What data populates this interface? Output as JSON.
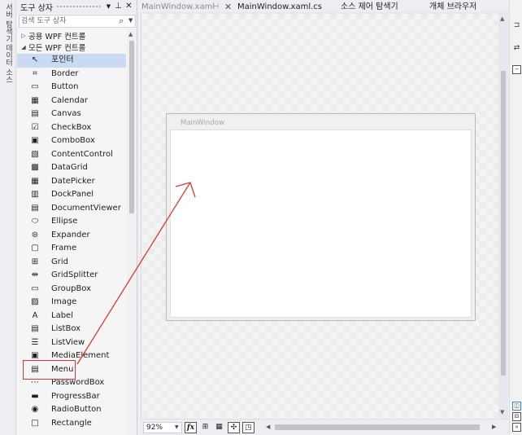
{
  "left_strip": {
    "items": [
      {
        "label": "서버 탐색기"
      },
      {
        "label": "데이터 소스"
      }
    ]
  },
  "toolbox": {
    "title": "도구 상자",
    "search_placeholder": "검색 도구 상자",
    "groups": [
      {
        "label": "공용 WPF 컨트롤",
        "state": "collapsed"
      },
      {
        "label": "모든 WPF 컨트롤",
        "state": "expanded"
      }
    ],
    "items": [
      {
        "label": "포인터",
        "icon": "pointer-icon",
        "glyph": "↖",
        "selected": true
      },
      {
        "label": "Border",
        "icon": "border-icon",
        "glyph": "⌗"
      },
      {
        "label": "Button",
        "icon": "button-icon",
        "glyph": "▭"
      },
      {
        "label": "Calendar",
        "icon": "calendar-icon",
        "glyph": "▦"
      },
      {
        "label": "Canvas",
        "icon": "canvas-icon",
        "glyph": "▤"
      },
      {
        "label": "CheckBox",
        "icon": "checkbox-icon",
        "glyph": "☑"
      },
      {
        "label": "ComboBox",
        "icon": "combobox-icon",
        "glyph": "▣"
      },
      {
        "label": "ContentControl",
        "icon": "contentcontrol-icon",
        "glyph": "▧"
      },
      {
        "label": "DataGrid",
        "icon": "datagrid-icon",
        "glyph": "▩"
      },
      {
        "label": "DatePicker",
        "icon": "datepicker-icon",
        "glyph": "▦"
      },
      {
        "label": "DockPanel",
        "icon": "dockpanel-icon",
        "glyph": "▥"
      },
      {
        "label": "DocumentViewer",
        "icon": "documentviewer-icon",
        "glyph": "▤"
      },
      {
        "label": "Ellipse",
        "icon": "ellipse-icon",
        "glyph": "⬭"
      },
      {
        "label": "Expander",
        "icon": "expander-icon",
        "glyph": "⊜"
      },
      {
        "label": "Frame",
        "icon": "frame-icon",
        "glyph": "▢"
      },
      {
        "label": "Grid",
        "icon": "grid-icon",
        "glyph": "⊞"
      },
      {
        "label": "GridSplitter",
        "icon": "gridsplitter-icon",
        "glyph": "⇹"
      },
      {
        "label": "GroupBox",
        "icon": "groupbox-icon",
        "glyph": "▭"
      },
      {
        "label": "Image",
        "icon": "image-icon",
        "glyph": "▨"
      },
      {
        "label": "Label",
        "icon": "label-icon",
        "glyph": "A"
      },
      {
        "label": "ListBox",
        "icon": "listbox-icon",
        "glyph": "▤"
      },
      {
        "label": "ListView",
        "icon": "listview-icon",
        "glyph": "☰"
      },
      {
        "label": "MediaElement",
        "icon": "mediaelement-icon",
        "glyph": "▣"
      },
      {
        "label": "Menu",
        "icon": "menu-icon",
        "glyph": "▤"
      },
      {
        "label": "PasswordBox",
        "icon": "passwordbox-icon",
        "glyph": "⋯"
      },
      {
        "label": "ProgressBar",
        "icon": "progressbar-icon",
        "glyph": "▬"
      },
      {
        "label": "RadioButton",
        "icon": "radiobutton-icon",
        "glyph": "◉"
      },
      {
        "label": "Rectangle",
        "icon": "rectangle-icon",
        "glyph": "□"
      }
    ]
  },
  "tabs": {
    "main": "MainWindow.xaml",
    "cs": "MainWindow.xaml.cs",
    "source_control": "소스 제어 탐색기",
    "object_browser": "개체 브라우저"
  },
  "designer": {
    "window_title": "MainWindow"
  },
  "bottom_bar": {
    "zoom": "92%",
    "fx": "fx"
  },
  "colors": {
    "accent": "#3b7fd2",
    "highlight_red": "#d63a3a",
    "selection": "#c9daf2"
  }
}
